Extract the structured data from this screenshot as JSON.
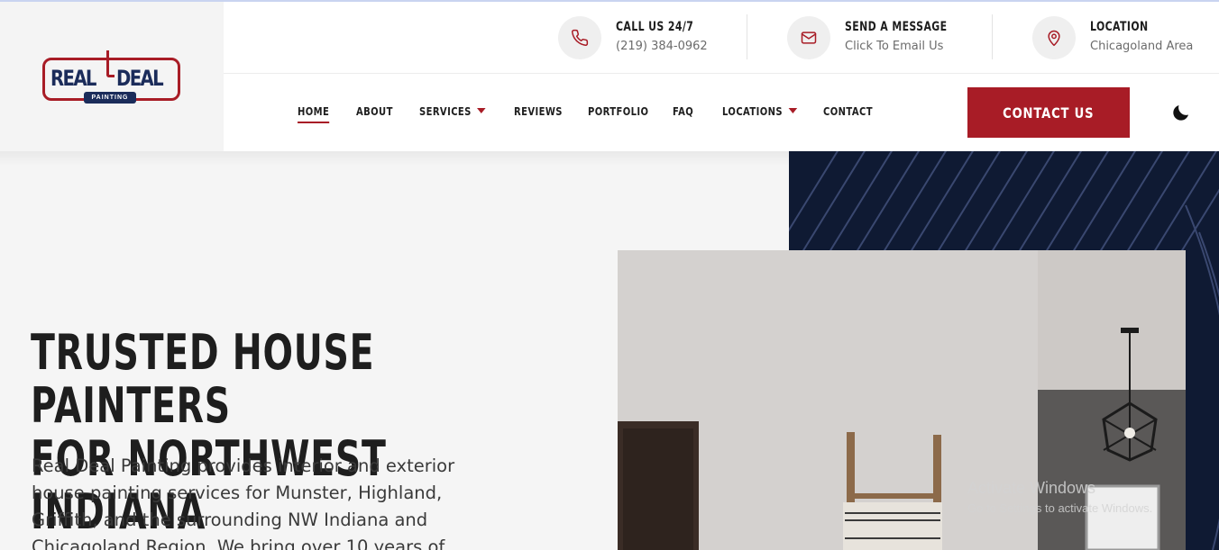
{
  "brand": {
    "logo_word_1": "REAL",
    "logo_word_2": "DEAL",
    "logo_badge": "PAINTING",
    "colors": {
      "red": "#a81c26",
      "navy": "#1b2c5a",
      "dark_panel": "#0f1a33"
    }
  },
  "contact_bar": [
    {
      "icon": "phone-icon",
      "title": "CALL US 24/7",
      "sub": "(219) 384-0962"
    },
    {
      "icon": "mail-icon",
      "title": "SEND A MESSAGE",
      "sub": "Click To Email Us"
    },
    {
      "icon": "location-pin-icon",
      "title": "LOCATION",
      "sub": "Chicagoland Area"
    }
  ],
  "nav": {
    "items": [
      {
        "label": "HOME",
        "active": true
      },
      {
        "label": "ABOUT"
      },
      {
        "label": "SERVICES",
        "dropdown": true
      },
      {
        "label": "REVIEWS"
      },
      {
        "label": "PORTFOLIO"
      },
      {
        "label": "FAQ"
      },
      {
        "label": "LOCATIONS",
        "dropdown": true
      },
      {
        "label": "CONTACT"
      }
    ],
    "cta_label": "CONTACT US",
    "theme_toggle_icon": "moon-icon"
  },
  "hero": {
    "title_line_1": "TRUSTED HOUSE PAINTERS",
    "title_line_2": "FOR NORTHWEST INDIANA",
    "text": "Real Deal Painting provides interior and exterior house painting services for Munster, Highland, Griffith, and the surrounding NW Indiana and Chicagoland Region. We bring over 10 years of"
  },
  "watermark": {
    "title": "Activate Windows",
    "sub": "Go to Settings to activate Windows."
  }
}
